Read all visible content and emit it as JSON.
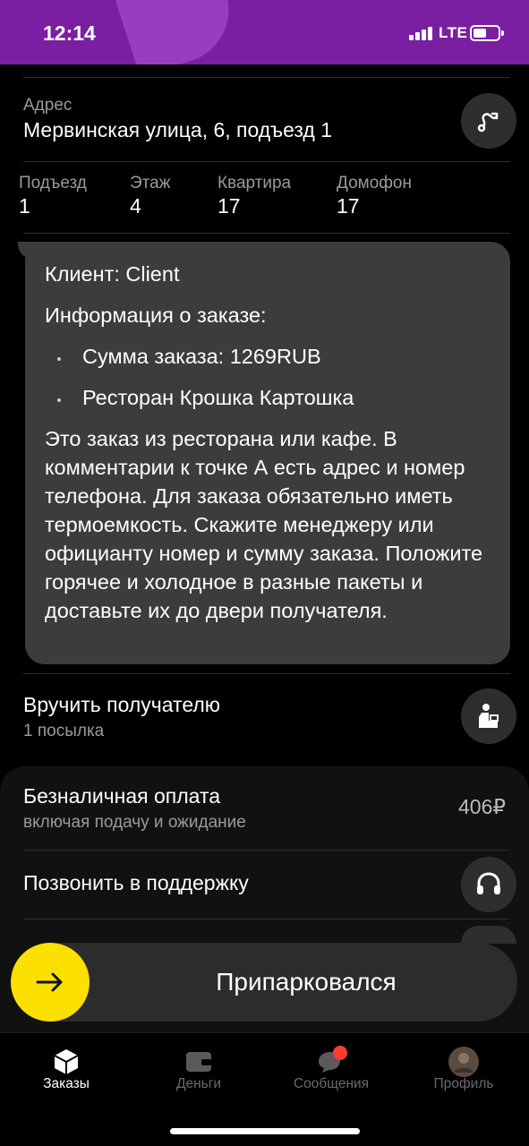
{
  "status": {
    "time": "12:14",
    "network": "LTE"
  },
  "address": {
    "label": "Адрес",
    "value": "Мервинская улица, 6, подъезд 1",
    "route_icon": "route-icon"
  },
  "details": [
    {
      "label": "Подъезд",
      "value": "1"
    },
    {
      "label": "Этаж",
      "value": "4"
    },
    {
      "label": "Квартира",
      "value": "17"
    },
    {
      "label": "Домофон",
      "value": "17"
    }
  ],
  "message": {
    "client": "Клиент: Client",
    "info_title": "Информация о заказе:",
    "items": [
      "Сумма заказа: 1269RUB",
      "Ресторан Крошка Картошка"
    ],
    "note": "Это заказ из ресторана или кафе. В комментарии к точке А есть адрес и номер телефона. Для заказа обязательно иметь термоемкость. Скажите менеджеру или официанту номер и сумму заказа. Положите горячее и холодное в разные пакеты и доставьте их до двери получателя."
  },
  "handover": {
    "title": "Вручить получателю",
    "subtitle": "1 посылка",
    "icon": "person-handover-icon"
  },
  "payment": {
    "title": "Безналичная оплата",
    "subtitle": "включая подачу и ожидание",
    "amount": "406₽"
  },
  "support": {
    "title": "Позвонить в поддержку",
    "icon": "headset-icon"
  },
  "park_button": {
    "label": "Припарковался",
    "icon": "arrow-right-icon",
    "color": "#fce000"
  },
  "tabs": [
    {
      "label": "Заказы",
      "icon": "box-icon",
      "active": true
    },
    {
      "label": "Деньги",
      "icon": "wallet-icon",
      "active": false
    },
    {
      "label": "Сообщения",
      "icon": "chat-icon",
      "active": false,
      "badge_color": "#ff3b30"
    },
    {
      "label": "Профиль",
      "icon": "avatar-icon",
      "active": false
    }
  ],
  "colors": {
    "statusbar": "#7b1fa2",
    "accent": "#fce000",
    "badge": "#ff3b30"
  }
}
